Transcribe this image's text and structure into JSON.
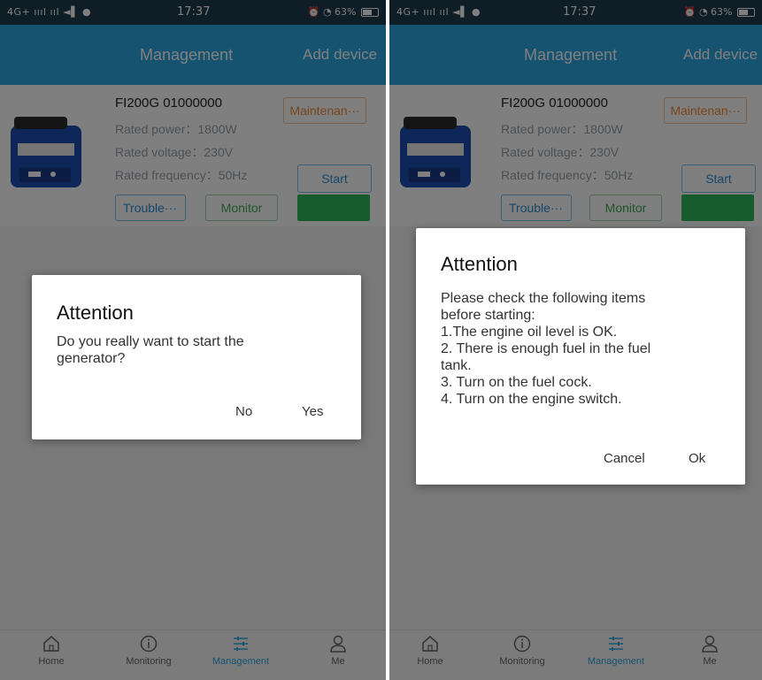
{
  "screens": [
    {
      "status": {
        "signal": "4G+ ıııl ııl ◄▌ ●",
        "time": "17:37",
        "battery": "63%"
      },
      "appbar": {
        "title": "Management",
        "action": "Add device"
      },
      "device": {
        "name": "FI200G 01000000",
        "rated_power": "Rated power：1800W",
        "rated_voltage": "Rated voltage：230V",
        "rated_frequency": "Rated frequency：50Hz",
        "status_badge": "Maintenan···",
        "start_label": "Start",
        "trouble_label": "Trouble···",
        "monitor_label": "Monitor",
        "status_color": "#2fb85a"
      },
      "dialog": {
        "title": "Attention",
        "message_lines": [
          "Do you really want to start the",
          "generator?"
        ],
        "negative": "No",
        "positive": "Yes"
      },
      "tabs": [
        {
          "label": "Home",
          "icon": "home-icon"
        },
        {
          "label": "Monitoring",
          "icon": "info-icon"
        },
        {
          "label": "Management",
          "icon": "sliders-icon",
          "active": true
        },
        {
          "label": "Me",
          "icon": "person-icon"
        }
      ]
    },
    {
      "status": {
        "signal": "4G+ ıııl ııl ◄▌ ●",
        "time": "17:37",
        "battery": "63%"
      },
      "appbar": {
        "title": "Management",
        "action": "Add device"
      },
      "device": {
        "name": "FI200G 01000000",
        "rated_power": "Rated power：1800W",
        "rated_voltage": "Rated voltage：230V",
        "rated_frequency": "Rated frequency：50Hz",
        "status_badge": "Maintenan···",
        "start_label": "Start",
        "trouble_label": "Trouble···",
        "monitor_label": "Monitor",
        "status_color": "#2fb85a"
      },
      "dialog": {
        "title": "Attention",
        "message_lines": [
          "Please check the following items",
          "before starting:",
          "1.The engine oil level is OK.",
          "2. There is enough fuel in the fuel",
          "tank.",
          "3. Turn on the fuel cock.",
          "4. Turn on the engine switch."
        ],
        "negative": "Cancel",
        "positive": "Ok"
      },
      "tabs": [
        {
          "label": "Home",
          "icon": "home-icon"
        },
        {
          "label": "Monitoring",
          "icon": "info-icon"
        },
        {
          "label": "Management",
          "icon": "sliders-icon",
          "active": true
        },
        {
          "label": "Me",
          "icon": "person-icon"
        }
      ]
    }
  ],
  "colors": {
    "appbar": "#2da6e3",
    "statusbar": "#1e3a4c",
    "accent_orange": "#f08b3a",
    "accent_green": "#2fb85a"
  }
}
